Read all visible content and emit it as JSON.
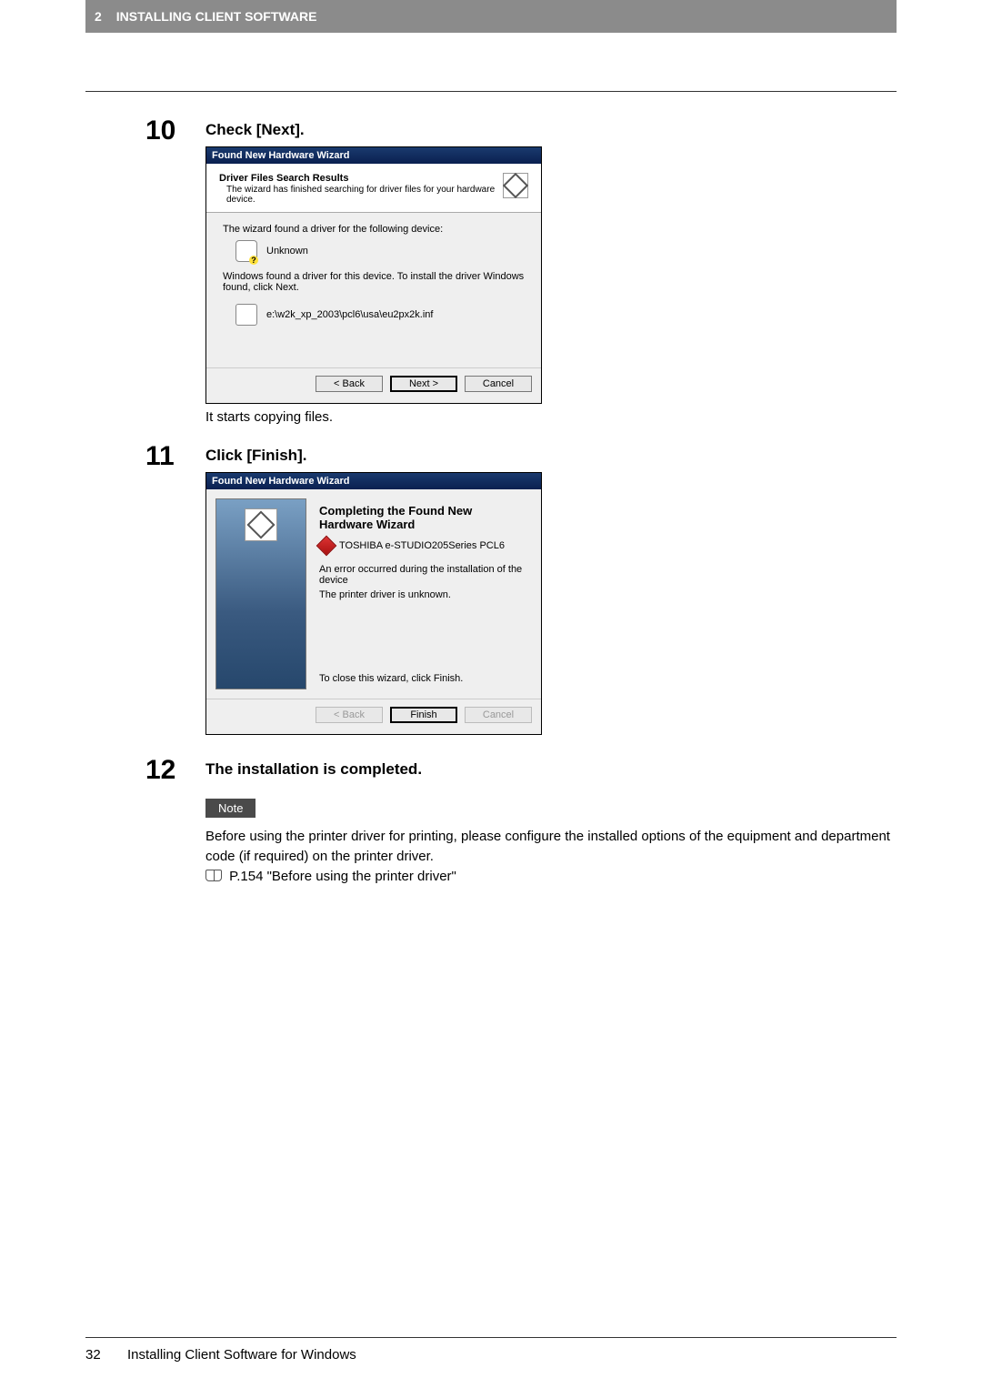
{
  "header": {
    "chapter_num": "2",
    "chapter_title": "INSTALLING CLIENT SOFTWARE"
  },
  "steps": {
    "s10": {
      "num": "10",
      "title": "Check [Next].",
      "wizard_title": "Found New Hardware Wizard",
      "head_title": "Driver Files Search Results",
      "head_sub": "The wizard has finished searching for driver files for your hardware device.",
      "body_line1": "The wizard found a driver for the following device:",
      "device_name": "Unknown",
      "body_line2": "Windows found a driver for this device. To install the driver Windows found, click Next.",
      "inf_path": "e:\\w2k_xp_2003\\pcl6\\usa\\eu2px2k.inf",
      "btn_back": "< Back",
      "btn_next": "Next >",
      "btn_cancel": "Cancel",
      "caption": "It starts copying files."
    },
    "s11": {
      "num": "11",
      "title": "Click [Finish].",
      "wizard_title": "Found New Hardware Wizard",
      "complete_h": "Completing the Found New Hardware Wizard",
      "device_line": "TOSHIBA e-STUDIO205Series PCL6",
      "error_line": "An error occurred during the installation of the device",
      "unknown_line": "The printer driver is unknown.",
      "close_line": "To close this wizard, click Finish.",
      "btn_back": "< Back",
      "btn_finish": "Finish",
      "btn_cancel": "Cancel"
    },
    "s12": {
      "num": "12",
      "title": "The installation is completed.",
      "note_label": "Note",
      "note_body_l1": "Before using the printer driver for printing, please configure the installed options of the equipment and department code (if required) on the printer driver.",
      "note_ref": " P.154 \"Before using the printer driver\""
    }
  },
  "footer": {
    "page": "32",
    "text": "Installing Client Software for Windows"
  }
}
